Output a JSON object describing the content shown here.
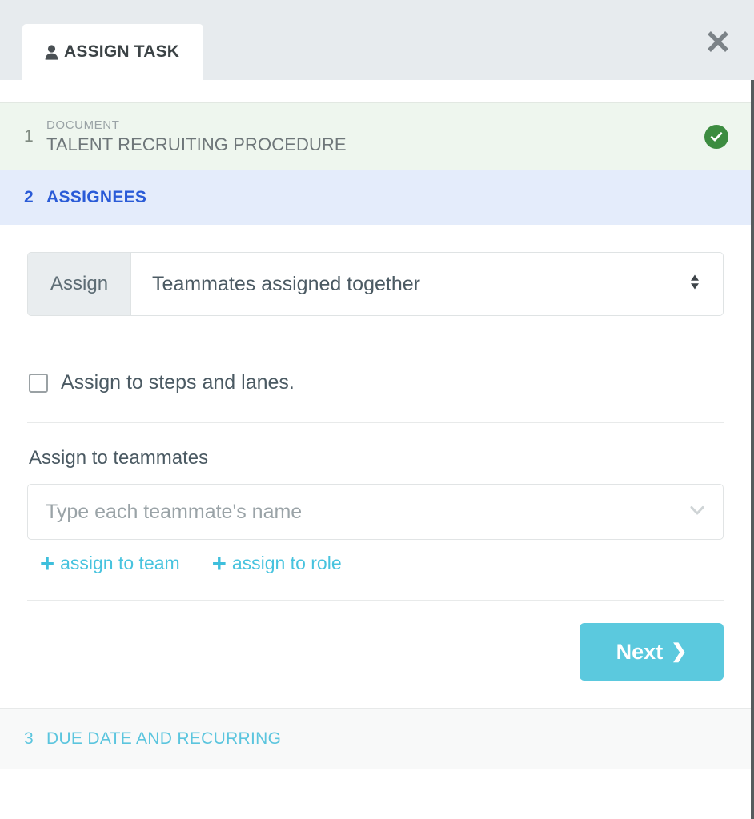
{
  "window": {
    "tab_label": "ASSIGN TASK",
    "tab_icon": "user-icon",
    "close_icon": "close-icon"
  },
  "steps": [
    {
      "number": "1",
      "kicker": "DOCUMENT",
      "title": "TALENT RECRUITING PROCEDURE",
      "state": "completed",
      "status_icon": "check-circle-icon"
    },
    {
      "number": "2",
      "title": "ASSIGNEES",
      "state": "active"
    },
    {
      "number": "3",
      "title": "DUE DATE AND RECURRING",
      "state": "pending"
    }
  ],
  "form": {
    "assign_prefix_label": "Assign",
    "assign_mode_value": "Teammates assigned together",
    "assign_mode_options": [
      "Teammates assigned together"
    ],
    "steps_lanes_checkbox_label": "Assign to steps and lanes.",
    "steps_lanes_checked": false,
    "teammates_label": "Assign to teammates",
    "teammates_placeholder": "Type each teammate's name",
    "teammates_value": "",
    "add_links": [
      {
        "label": "assign to team",
        "icon": "plus-icon"
      },
      {
        "label": "assign to role",
        "icon": "plus-icon"
      }
    ],
    "next_label": "Next",
    "next_chevron": "❯"
  },
  "colors": {
    "accent_cyan": "#5bc9de",
    "link_cyan": "#47c3de",
    "active_blue": "#2a5bd7",
    "success_green": "#3c8c40",
    "step_done_bg": "#eef6ee",
    "step_active_bg": "#e4ecfb",
    "step_pending_bg": "#f8f9f9",
    "header_bg": "#e7ebee"
  }
}
